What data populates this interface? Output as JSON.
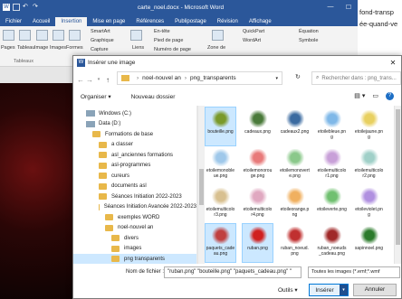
{
  "word": {
    "title": "carte_noel.docx - Microsoft Word",
    "min": "—",
    "max": "☐",
    "close": "✕",
    "tabs": [
      "Fichier",
      "Accueil",
      "Insertion",
      "Mise en page",
      "Références",
      "Publipostage",
      "Révision",
      "Affichage"
    ],
    "ribbon": {
      "pages": "Pages",
      "tableau": "Tableau",
      "image": "Image",
      "images": "Images",
      "formes": "Formes",
      "smartart": "SmartArt",
      "graphique": "Graphique",
      "capture": "Capture",
      "liens": "Liens",
      "entete": "En-tête",
      "pied": "Pied de page",
      "numero": "Numéro de page",
      "zone": "Zone de",
      "quickpart": "QuickPart",
      "wordart": "WordArt",
      "equation": "Équation",
      "symbole": "Symbole",
      "group_tableaux": "Tableaux"
    },
    "side_text_1": "fond-transp",
    "side_text_2": "ée-quand-ve"
  },
  "dialog": {
    "title": "Insérer une image",
    "close": "✕",
    "breadcrumb": [
      "noel-nouvel an",
      "png_transparents"
    ],
    "search_placeholder": "Rechercher dans : png_trans...",
    "organize": "Organiser ▾",
    "new_folder": "Nouveau dossier",
    "help": "?",
    "nav": [
      {
        "label": "Windows (C:)",
        "type": "drive",
        "indent": 0,
        "selected": false
      },
      {
        "label": "Data (D:)",
        "type": "drive",
        "indent": 0,
        "selected": false
      },
      {
        "label": "Formations de base",
        "type": "folder",
        "indent": 1,
        "selected": false
      },
      {
        "label": "a classer",
        "type": "folder",
        "indent": 2,
        "selected": false
      },
      {
        "label": "asl_anciennes formations",
        "type": "folder",
        "indent": 2,
        "selected": false
      },
      {
        "label": "asl-programmes",
        "type": "folder",
        "indent": 2,
        "selected": false
      },
      {
        "label": "cureurs",
        "type": "folder",
        "indent": 2,
        "selected": false
      },
      {
        "label": "documents asl",
        "type": "folder",
        "indent": 2,
        "selected": false
      },
      {
        "label": "Séances Initiation 2022-2023",
        "type": "folder",
        "indent": 2,
        "selected": false
      },
      {
        "label": "Séances Initiation Avancée 2022-2023",
        "type": "folder",
        "indent": 2,
        "selected": false
      },
      {
        "label": "exemples WORD",
        "type": "folder",
        "indent": 3,
        "selected": false
      },
      {
        "label": "noel-nouvel an",
        "type": "folder",
        "indent": 3,
        "selected": false
      },
      {
        "label": "divers",
        "type": "folder",
        "indent": 4,
        "selected": false
      },
      {
        "label": "images",
        "type": "folder",
        "indent": 4,
        "selected": false
      },
      {
        "label": "png transparents",
        "type": "folder",
        "indent": 4,
        "selected": true
      }
    ],
    "files": [
      {
        "name": "bouteille.png",
        "selected": true,
        "color": "#7a9a2a"
      },
      {
        "name": "cadeaux.png",
        "selected": false,
        "color": "#4a7a3a"
      },
      {
        "name": "cadeaux2.png",
        "selected": false,
        "color": "#3a6aa0"
      },
      {
        "name": "etoilebleue.png",
        "selected": false,
        "color": "#7fb8e8"
      },
      {
        "name": "etoilejaune.png",
        "selected": false,
        "color": "#e8d060"
      },
      {
        "name": "etoilemonobleue.png",
        "selected": false,
        "color": "#9fc8ea"
      },
      {
        "name": "etoilemonorouge.png",
        "selected": false,
        "color": "#e87a7a"
      },
      {
        "name": "etoilemonoverte.png",
        "selected": false,
        "color": "#8ac88a"
      },
      {
        "name": "etoilemulticolor1.png",
        "selected": false,
        "color": "#c8a0d8"
      },
      {
        "name": "etoilemulticolor2.png",
        "selected": false,
        "color": "#a0d0c8"
      },
      {
        "name": "etoilemulticolor3.png",
        "selected": false,
        "color": "#d8c090"
      },
      {
        "name": "etoilemulticolor4.png",
        "selected": false,
        "color": "#e0a8c0"
      },
      {
        "name": "etoileorange.png",
        "selected": false,
        "color": "#f0b060"
      },
      {
        "name": "etoileverte.png",
        "selected": false,
        "color": "#70c070"
      },
      {
        "name": "etoileviolet.png",
        "selected": false,
        "color": "#b090e0"
      },
      {
        "name": "paquets_cadeau.png",
        "selected": true,
        "color": "#c04040"
      },
      {
        "name": "ruban.png",
        "selected": true,
        "color": "#d02020"
      },
      {
        "name": "ruban_noeud.png",
        "selected": false,
        "color": "#c03030"
      },
      {
        "name": "ruban_noeuds_cadeau.png",
        "selected": false,
        "color": "#a02828"
      },
      {
        "name": "sapinnoel.png",
        "selected": false,
        "color": "#2a7a2a"
      }
    ],
    "filename_label": "Nom de fichier :",
    "filename_value": "\"ruban.png\" \"bouteille.png\" \"paquets_cadeau.png\" \"",
    "filetype_value": "Toutes les images (*.emf;*.wmf",
    "tools": "Outils ▾",
    "insert": "Insérer",
    "cancel": "Annuler"
  }
}
